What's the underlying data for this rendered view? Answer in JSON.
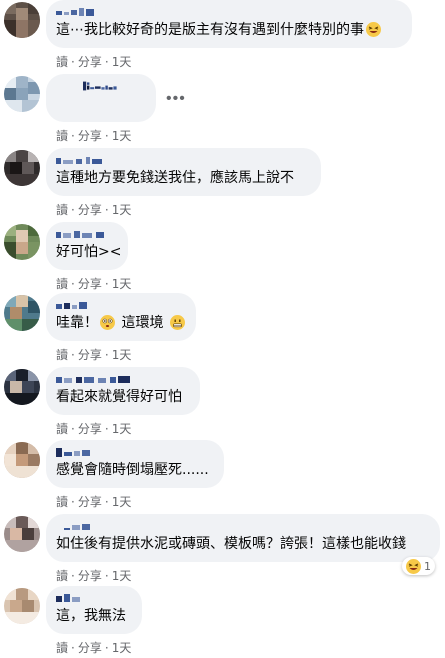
{
  "actions": {
    "read": "讀",
    "share": "分享",
    "sep": "·",
    "time": "1天"
  },
  "comments": [
    {
      "text": "這⋯我比較好奇的是版主有沒有遇到什麼特別的事",
      "emoji": "laughing-emoji"
    },
    {
      "text": "",
      "more": "•••"
    },
    {
      "text": "這種地方要免錢送我住，應該馬上說不"
    },
    {
      "text": "好可怕><"
    },
    {
      "text_a": "哇靠！",
      "text_b": "這環境",
      "emoji_a": "flushed-emoji",
      "emoji_b": "grimacing-emoji"
    },
    {
      "text": "看起來就覺得好可怕"
    },
    {
      "text": "感覺會隨時倒塌壓死......"
    },
    {
      "text": "如住後有提供水泥或磚頭、模板嗎？誇張！這樣也能收錢",
      "reaction_count": "1"
    },
    {
      "text": "這，我無法"
    }
  ],
  "colors": {
    "bubble": "#f0f2f5",
    "meta": "#65676b",
    "text": "#050505"
  }
}
